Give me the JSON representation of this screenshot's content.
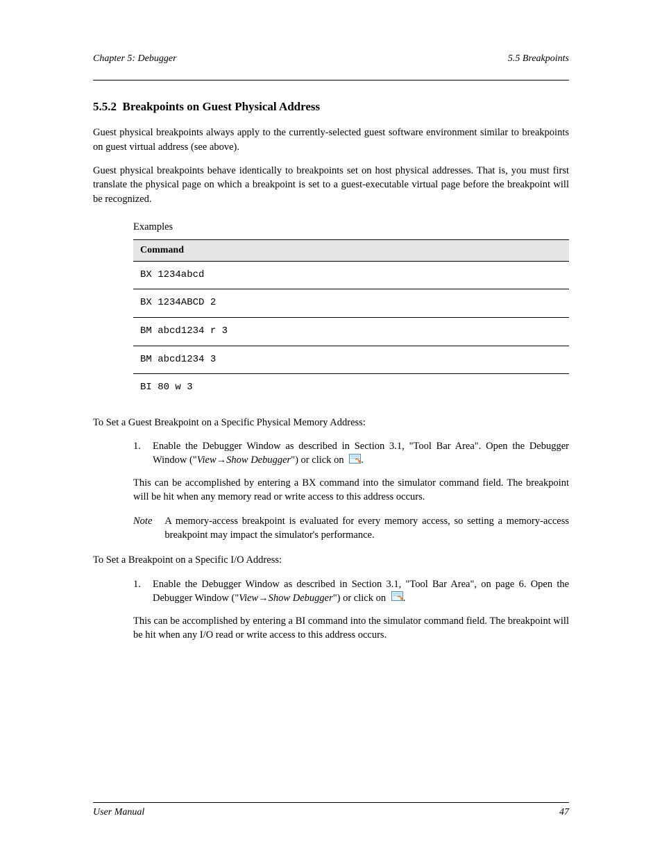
{
  "header": {
    "chapter_label": "5.5",
    "chapter_title": "Breakpoints"
  },
  "subsection": {
    "number": "5.5.2",
    "title": "Breakpoints on Guest Physical Address"
  },
  "intro_p1": "Guest physical breakpoints always apply to the currently-selected guest software environment similar to breakpoints on guest virtual address (see above).",
  "intro_p2": "Guest physical breakpoints behave identically to breakpoints set on host physical addresses. That is, you must first translate the physical page on which a breakpoint is set to a guest-executable virtual page before the breakpoint will be recognized.",
  "examples_label": "Examples",
  "examples_table": {
    "header": "Command",
    "rows": [
      "BX 1234abcd",
      "BX 1234ABCD 2",
      "BM abcd1234 r 3",
      "BM abcd1234 3",
      "BI 80 w 3"
    ]
  },
  "proc1": {
    "heading": "To Set a Guest Breakpoint on a Specific Physical Memory Address:",
    "step_num": "1.",
    "step_pre": "Enable the Debugger Window as described in",
    "step_link_text": "Section 3.1",
    "step_post1": ", \"",
    "step_link_text2": "Tool Bar Area",
    "step_post2": "\". Open the Debugger Window (\"",
    "step_italic": "View→Show Debugger",
    "step_post3": "\") or click on ",
    "step_post4": ".",
    "after": "This can be accomplished by entering a BX command into the simulator command field. The breakpoint will be hit when any memory read or write access to this address occurs."
  },
  "note": {
    "label": "Note",
    "body": "A memory-access breakpoint is evaluated for every memory access, so setting a memory-access breakpoint may impact the simulator's performance."
  },
  "proc2": {
    "heading": "To Set a Breakpoint on a Specific I/O Address:",
    "step_num": "1.",
    "step_pre": "Enable the Debugger Window as described in",
    "step_link_text": "Section 3.1",
    "step_post1": ", \"",
    "step_link_text2": "Tool Bar Area",
    "step_post2": "\", on page",
    "step_page": "6",
    "step_post3": ". Open the Debugger Window (\"",
    "step_italic": "View→Show Debugger",
    "step_post4": "\") or click on",
    "step_post5": ".",
    "after": "This can be accomplished by entering a BI command into the simulator command field. The breakpoint will be hit when any I/O read or write access to this address occurs."
  },
  "footer": {
    "doc_ref": "User Manual",
    "page_num": "47"
  }
}
